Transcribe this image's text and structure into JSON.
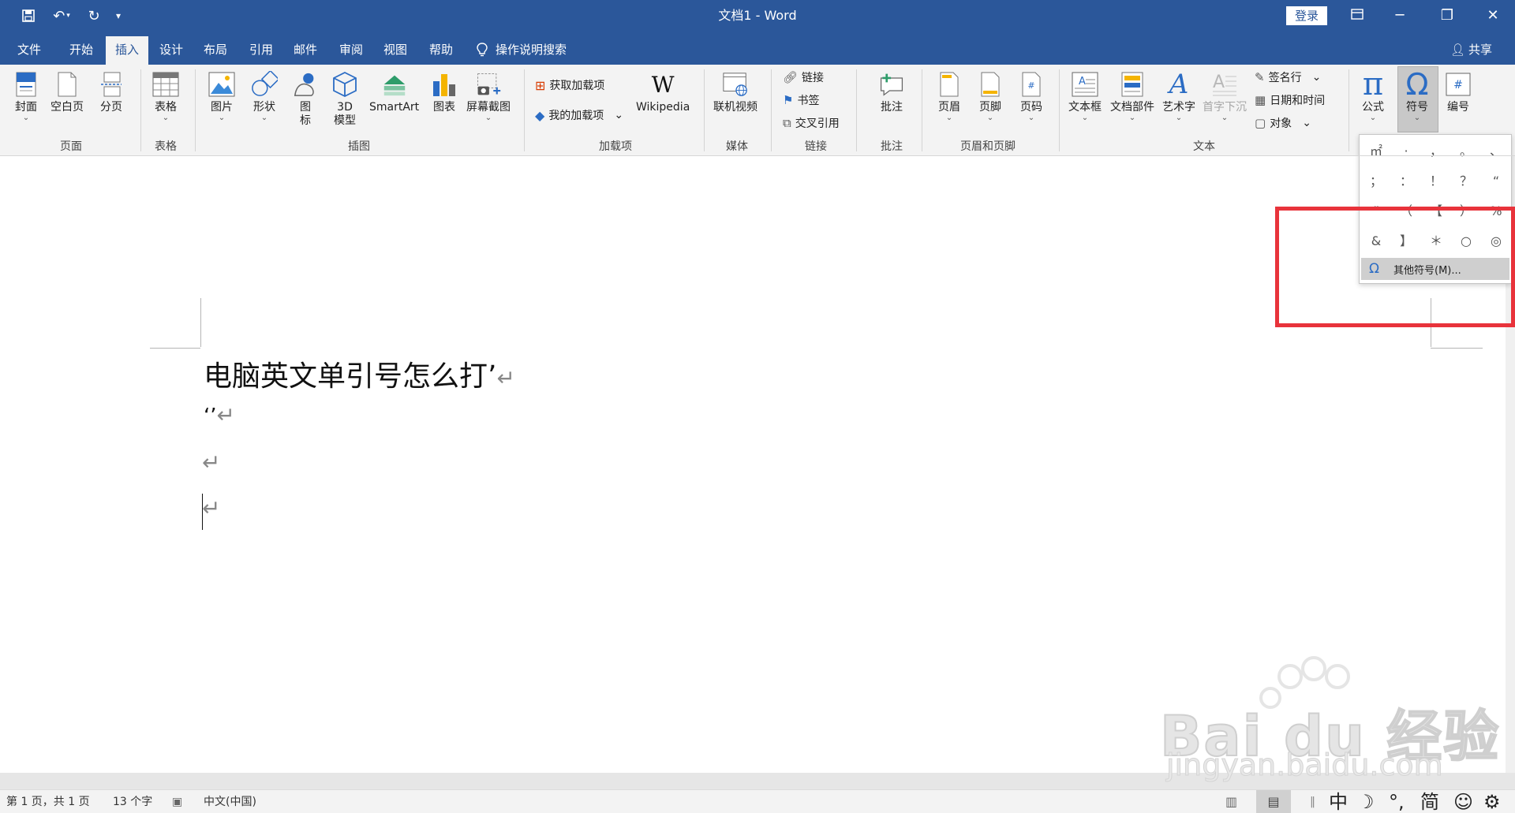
{
  "titlebar": {
    "title": "文档1  -  Word",
    "login_label": "登录",
    "icons": [
      "save-icon",
      "undo-icon",
      "redo-icon",
      "customize-icon"
    ]
  },
  "tabs": [
    "文件",
    "开始",
    "插入",
    "设计",
    "布局",
    "引用",
    "邮件",
    "审阅",
    "视图",
    "帮助"
  ],
  "active_tab": "插入",
  "search_label": "操作说明搜索",
  "share_label": "共享",
  "ribbon": {
    "pages": {
      "cover": "封面",
      "blank": "空白页",
      "break": "分页",
      "group": "页面"
    },
    "tables": {
      "table": "表格",
      "group": "表格"
    },
    "illustrations": {
      "picture": "图片",
      "shapes": "形状",
      "icons_1": "图",
      "icons_2": "标",
      "model_1": "3D",
      "model_2": "模型",
      "smartart": "SmartArt",
      "chart": "图表",
      "screenshot": "屏幕截图",
      "group": "插图"
    },
    "addins": {
      "get": "获取加载项",
      "mine": "我的加载项",
      "wikipedia": "Wikipedia",
      "wiki_glyph": "W",
      "group": "加载项"
    },
    "media": {
      "video": "联机视频",
      "group": "媒体"
    },
    "links": {
      "link": "链接",
      "bookmark": "书签",
      "crossref": "交叉引用",
      "group": "链接"
    },
    "comments": {
      "comment": "批注",
      "group": "批注"
    },
    "headerfooter": {
      "header": "页眉",
      "footer": "页脚",
      "pagenum": "页码",
      "group": "页眉和页脚"
    },
    "text": {
      "textbox": "文本框",
      "parts": "文档部件",
      "wordart": "艺术字",
      "dropcap": "首字下沉",
      "signature": "签名行",
      "datetime": "日期和时间",
      "object": "对象",
      "group": "文本"
    },
    "symbols": {
      "equation": "公式",
      "symbol": "符号",
      "pi": "π",
      "omega": "Ω"
    },
    "numbering": {
      "label": "编号"
    }
  },
  "document": {
    "line1": "电脑英文单引号怎么打’",
    "line2": "‘’",
    "pilcrow": "↵"
  },
  "symbol_dropdown": {
    "symbols": [
      "㎡",
      "·",
      "，",
      "。",
      "、",
      "；",
      "：",
      "！",
      "？",
      "“",
      "”",
      "（",
      "【",
      "）",
      "%",
      "&",
      "】",
      "＊",
      "○",
      "◎"
    ],
    "omega": "Ω",
    "more_label": "其他符号(M)..."
  },
  "watermark": {
    "brand": "Bai du 经验",
    "url": "jingyan.baidu.com"
  },
  "statusbar": {
    "page": "第 1 页，共 1 页",
    "words": "13 个字",
    "language": "中文(中国)",
    "ime": [
      "中",
      "☽",
      "°,",
      "简",
      "☺",
      "⚙"
    ]
  },
  "colors": {
    "brand": "#2b579a",
    "highlight": "#e8333b"
  }
}
